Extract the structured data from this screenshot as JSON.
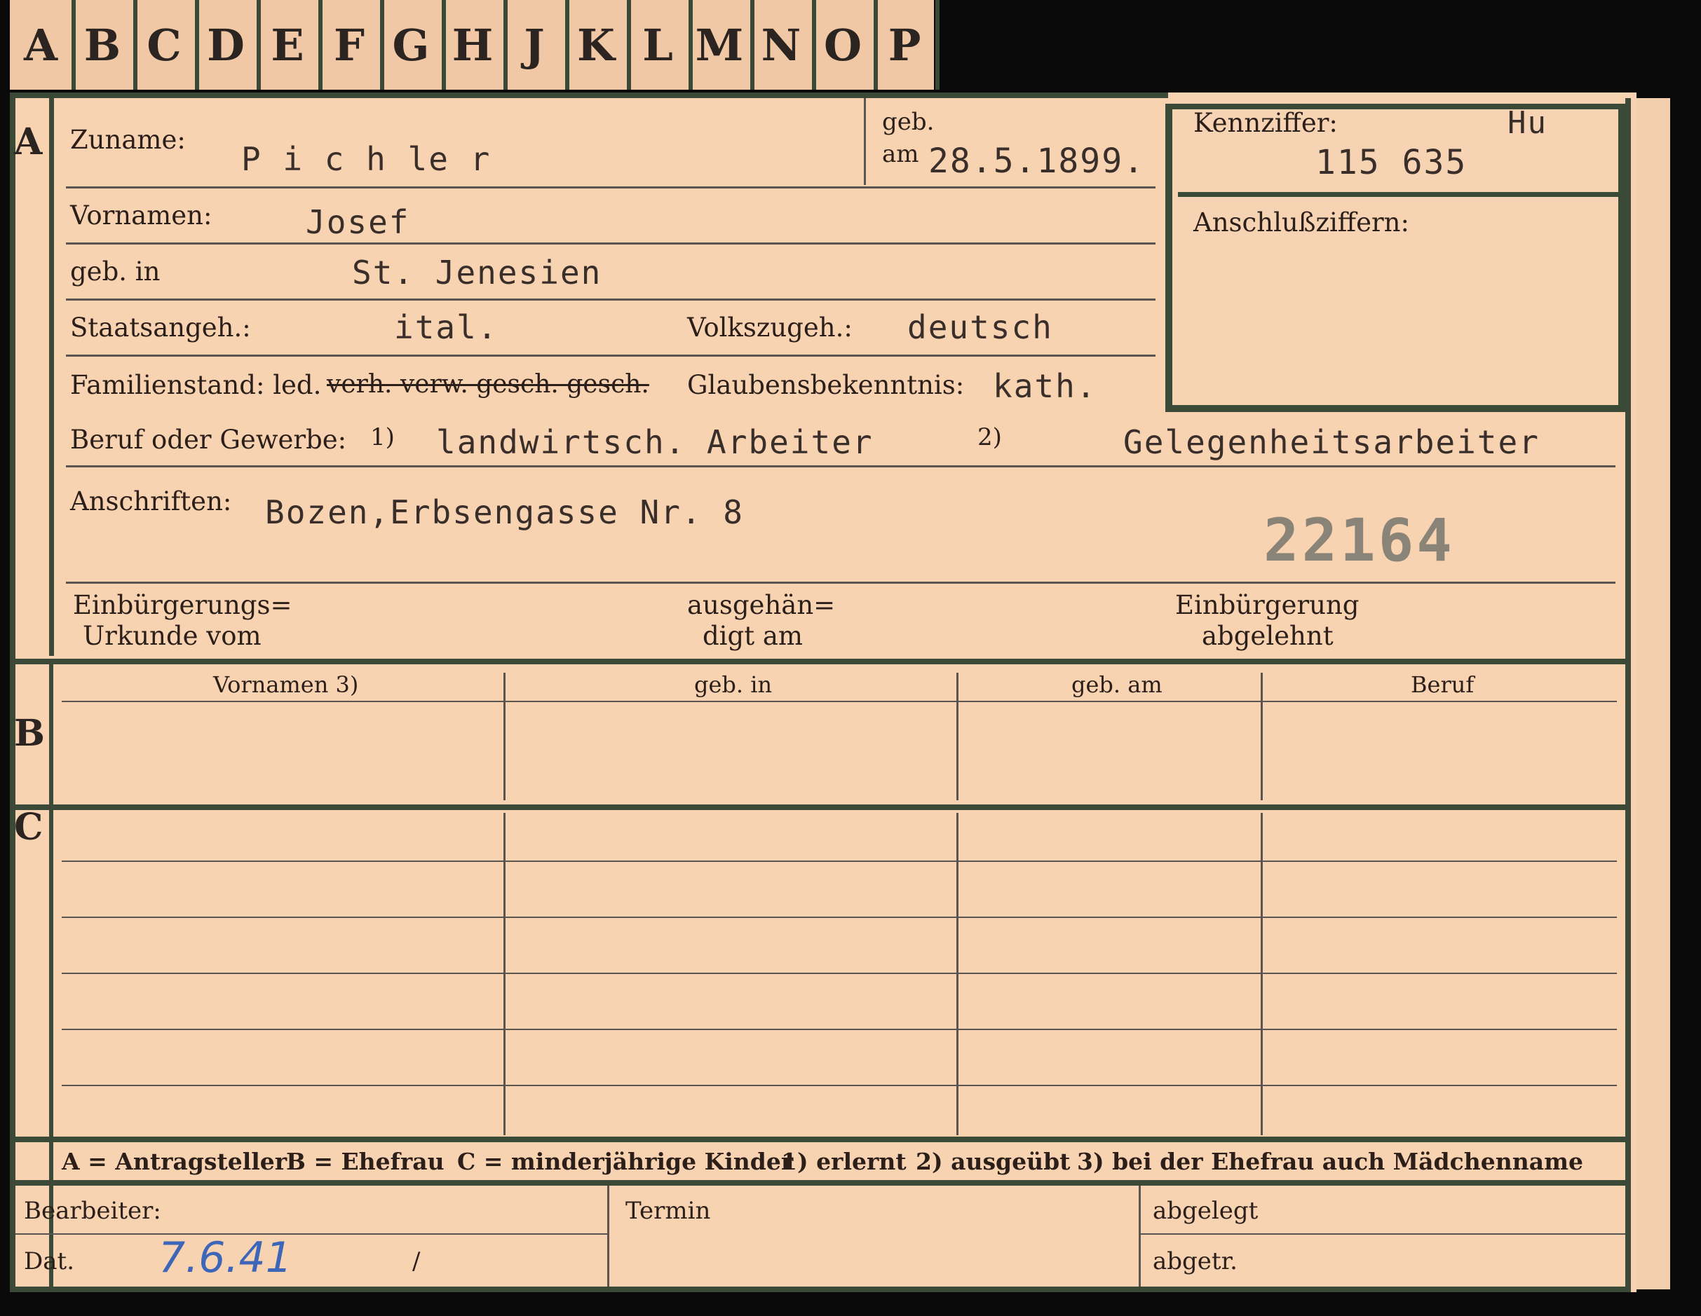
{
  "tabs": [
    "A",
    "B",
    "C",
    "D",
    "E",
    "F",
    "G",
    "H",
    "J",
    "K",
    "L",
    "M",
    "N",
    "O",
    "P"
  ],
  "section_letters": {
    "a": "A",
    "b": "B",
    "c": "C"
  },
  "labels": {
    "zuname": "Zuname:",
    "geb": "geb.",
    "am": "am",
    "kennziffer": "Kennziffer:",
    "anschluss": "Anschlußziffern:",
    "vornamen": "Vornamen:",
    "geb_in": "geb. in",
    "staatsangeh": "Staatsangeh.:",
    "volkszugeh": "Volkszugeh.:",
    "familienstand": "Familienstand: led.",
    "glauben": "Glaubensbekenntnis:",
    "beruf": "Beruf oder Gewerbe:",
    "beruf_n1": "1)",
    "beruf_n2": "2)",
    "anschriften": "Anschriften:",
    "einb_urk_1": "Einbürgerungs=",
    "einb_urk_2": "Urkunde vom",
    "ausgeh_1": "ausgehän=",
    "ausgeh_2": "digt am",
    "einb_abg_1": "Einbürgerung",
    "einb_abg_2": "abgelehnt"
  },
  "values": {
    "zuname": "P i c h le r",
    "geb_am": "28.5.1899.",
    "kenn_suffix": "Hu",
    "kenn_number": "115 635",
    "vornamen": "Josef",
    "geb_in": "St. Jenesien",
    "staatsangeh": "ital.",
    "volkszugeh": "deutsch",
    "familienstand_struck": "verh. verw. gesch. gesch.",
    "glauben": "kath.",
    "beruf_1": "landwirtsch. Arbeiter",
    "beruf_2": "Gelegenheitsarbeiter",
    "anschrift": "Bozen,Erbsengasse Nr. 8",
    "stamp_number": "22164"
  },
  "table_b": {
    "headers": [
      "Vornamen 3)",
      "geb. in",
      "geb. am",
      "Beruf"
    ]
  },
  "legend": {
    "a": "A = Antragsteller",
    "b": "B = Ehefrau",
    "c": "C = minderjährige Kinder",
    "n1": "1) erlernt",
    "n2": "2) ausgeübt",
    "n3": "3) bei der Ehefrau auch Mädchenname"
  },
  "footer": {
    "bearbeiter": "Bearbeiter:",
    "dat": "Dat.",
    "dat_value": "7.6.41",
    "dat_slash": "/",
    "termin": "Termin",
    "abgelegt": "abgelegt",
    "abgetr": "abgetr."
  },
  "colors": {
    "card": "#f7d3b2",
    "frame_green": "#3b4a37",
    "typewriter": "#3a2e2a",
    "pen_blue": "#3d66b8",
    "stamp_gray": "#8a8378"
  }
}
